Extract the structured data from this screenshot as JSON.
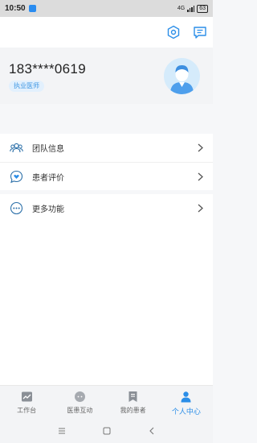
{
  "status_bar": {
    "time": "10:50",
    "network": "4G",
    "battery": "63"
  },
  "header": {
    "settings_icon": "hexagon-gear-icon",
    "message_icon": "chat-message-icon"
  },
  "profile": {
    "phone": "183****0619",
    "role": "执业医师",
    "avatar_icon": "doctor-avatar-icon"
  },
  "menu": [
    {
      "label": "团队信息",
      "icon": "team-icon"
    },
    {
      "label": "患者评价",
      "icon": "heart-chat-icon"
    },
    {
      "label": "更多功能",
      "icon": "more-dots-icon"
    }
  ],
  "tabs": [
    {
      "label": "工作台",
      "icon": "chart-icon",
      "active": false
    },
    {
      "label": "医患互动",
      "icon": "chat-bubble-icon",
      "active": false
    },
    {
      "label": "我的患者",
      "icon": "bookmark-list-icon",
      "active": false
    },
    {
      "label": "个人中心",
      "icon": "person-icon",
      "active": true
    }
  ],
  "colors": {
    "accent": "#2b8ee8",
    "badge_bg": "#e2f0fd",
    "avatar_bg": "#d5ebfb"
  }
}
